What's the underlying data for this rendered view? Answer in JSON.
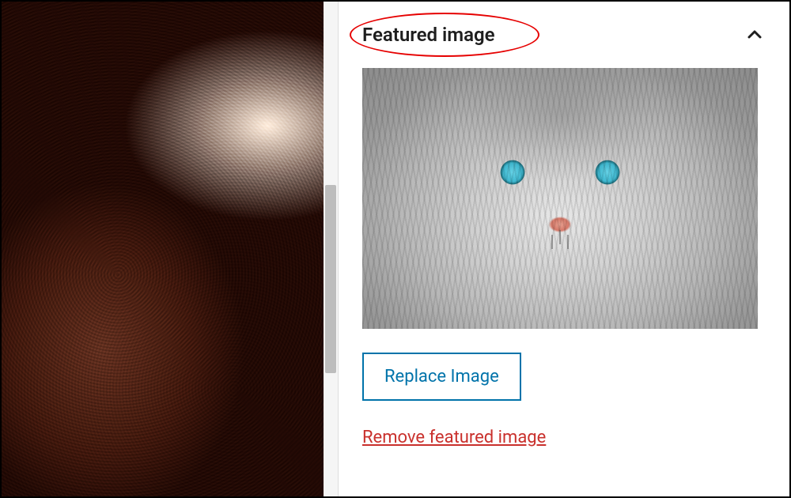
{
  "sidebar": {
    "featured_image": {
      "panel_title": "Featured image",
      "replace_label": "Replace Image",
      "remove_label": "Remove featured image",
      "thumb_alt": "cat-featured-image",
      "expanded": true
    }
  },
  "editor": {
    "block_image_alt": "post-image"
  },
  "annotation": {
    "highlight": "featured-image-title-circled"
  },
  "colors": {
    "link_primary": "#0073aa",
    "danger": "#c9302c",
    "annotation_red": "#e60000"
  }
}
